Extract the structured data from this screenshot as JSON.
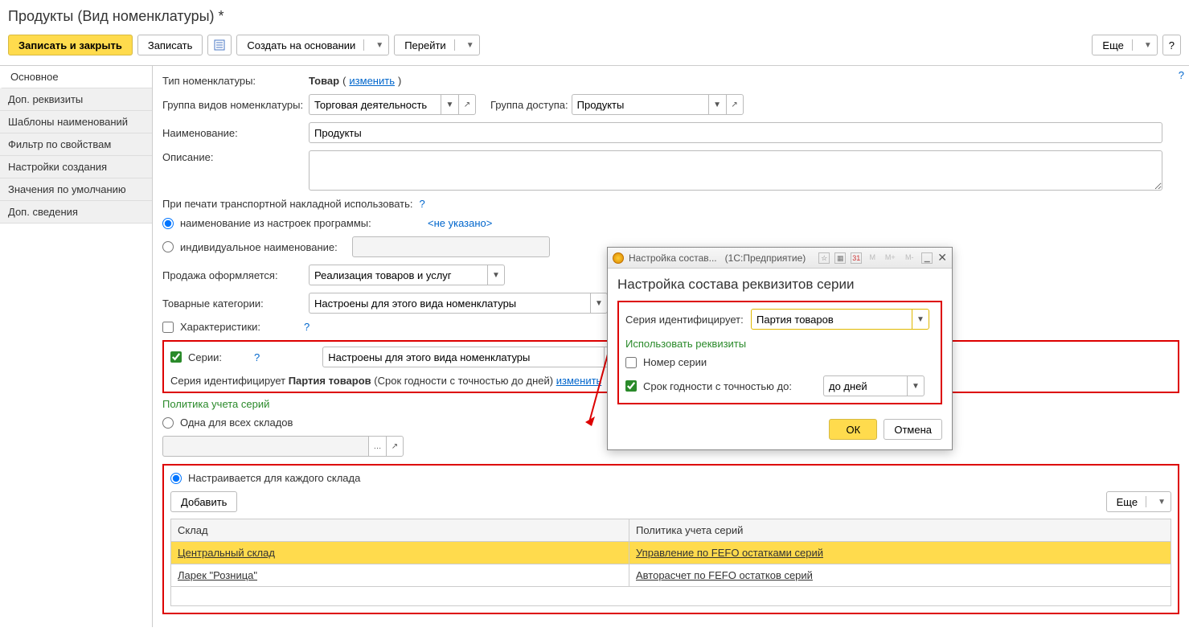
{
  "title": "Продукты (Вид номенклатуры) *",
  "toolbar": {
    "save_close": "Записать и закрыть",
    "save": "Записать",
    "create_based": "Создать на основании",
    "goto": "Перейти",
    "more": "Еще",
    "help": "?"
  },
  "sidebar": {
    "items": [
      "Основное",
      "Доп. реквизиты",
      "Шаблоны наименований",
      "Фильтр по свойствам",
      "Настройки создания",
      "Значения по умолчанию",
      "Доп. сведения"
    ]
  },
  "form": {
    "type_label": "Тип номенклатуры:",
    "type_value": "Товар",
    "type_change": "изменить",
    "group_label": "Группа видов номенклатуры:",
    "group_value": "Торговая деятельность",
    "access_label": "Группа доступа:",
    "access_value": "Продукты",
    "name_label": "Наименование:",
    "name_value": "Продукты",
    "desc_label": "Описание:",
    "print_label": "При печати транспортной накладной использовать:",
    "radio_prog": "наименование из настроек программы:",
    "radio_prog_val": "<не указано>",
    "radio_indiv": "индивидуальное наименование:",
    "sale_label": "Продажа оформляется:",
    "sale_value": "Реализация товаров и услуг",
    "categories_label": "Товарные категории:",
    "categories_value": "Настроены для этого вида номенклатуры",
    "characteristics_label": "Характеристики:",
    "series_label": "Серии:",
    "series_value": "Настроены для этого вида номенклатуры",
    "series_identifies_pre": "Серия идентифицирует ",
    "series_identifies_bold": "Партия товаров",
    "series_identifies_post": " (Срок годности с точностью до дней) ",
    "series_change": "изменить",
    "policy_title": "Политика учета серий",
    "radio_all": "Одна для всех складов",
    "radio_each": "Настраивается для каждого склада",
    "add_btn": "Добавить",
    "more_btn": "Еще"
  },
  "table": {
    "col_warehouse": "Склад",
    "col_policy": "Политика учета серий",
    "rows": [
      {
        "warehouse": "Центральный склад",
        "policy": "Управление по FEFO остатками серий",
        "selected": true
      },
      {
        "warehouse": "Ларек \"Розница\"",
        "policy": "Авторасчет по FEFO остатков серий",
        "selected": false
      }
    ]
  },
  "popup": {
    "title_short": "Настройка состав...",
    "app_tag": "(1С:Предприятие)",
    "m_labels": [
      "M",
      "M+",
      "M-"
    ],
    "heading": "Настройка состава реквизитов серии",
    "identifies_label": "Серия идентифицирует:",
    "identifies_value": "Партия товаров",
    "use_req_label": "Использовать реквизиты",
    "cb_number": "Номер серии",
    "cb_expiry": "Срок годности с точностью до:",
    "expiry_value": "до дней",
    "ok": "ОК",
    "cancel": "Отмена"
  }
}
